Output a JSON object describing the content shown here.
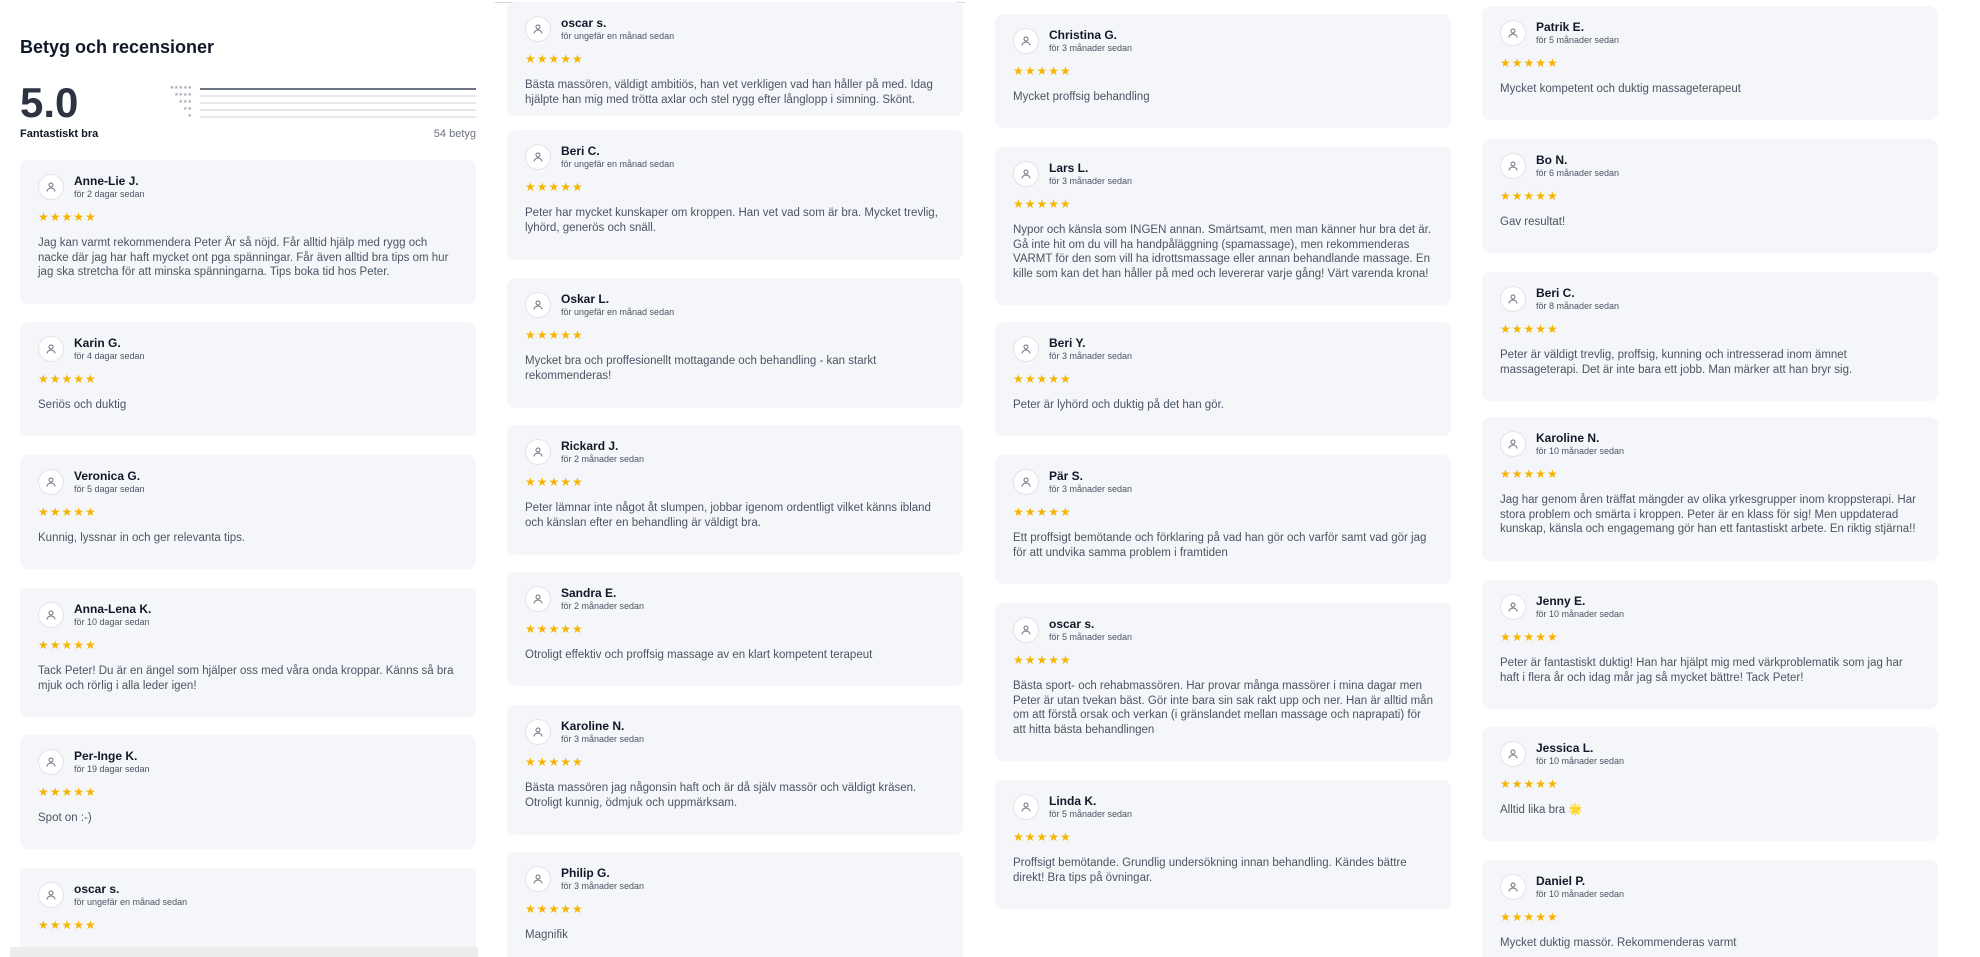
{
  "summary": {
    "title": "Betyg och recensioner",
    "score": "5.0",
    "score_label": "Fantastiskt bra",
    "count": "54 betyg",
    "distribution": [
      {
        "stars": 5,
        "share": 1.0
      },
      {
        "stars": 4,
        "share": 0
      },
      {
        "stars": 3,
        "share": 0
      },
      {
        "stars": 2,
        "share": 0
      },
      {
        "stars": 1,
        "share": 0
      }
    ]
  },
  "icons": {
    "avatar": "user-icon",
    "star": "star-icon"
  },
  "colors": {
    "star": "#f5b400",
    "card": "#f5f6fa"
  },
  "stars_text": "★★★★★",
  "columns": [
    [
      {
        "name": "Anne-Lie J.",
        "date": "för 2 dagar sedan",
        "text": "Jag kan varmt rekommendera Peter Är så nöjd. Får alltid hjälp med rygg och nacke där jag har haft mycket ont pga spänningar. Får även alltid bra tips om hur jag ska stretcha för att minska spänningarna. Tips boka tid hos Peter."
      },
      {
        "name": "Karin G.",
        "date": "för 4 dagar sedan",
        "text": "Seriös och duktig"
      },
      {
        "name": "Veronica G.",
        "date": "för 5 dagar sedan",
        "text": "Kunnig, lyssnar in och ger relevanta tips."
      },
      {
        "name": "Anna-Lena K.",
        "date": "för 10 dagar sedan",
        "text": "Tack Peter! Du är en ängel som hjälper oss med våra onda kroppar. Känns så bra mjuk och rörlig i alla leder igen!"
      },
      {
        "name": "Per-Inge K.",
        "date": "för 19 dagar sedan",
        "text": "Spot on :-)"
      },
      {
        "name": "oscar s.",
        "date": "för ungefär en månad sedan",
        "text": ""
      }
    ],
    [
      {
        "name": "oscar s.",
        "date": "för ungefär en månad sedan",
        "text": "Bästa massören, väldigt ambitiös, han vet verkligen vad han håller på med. Idag hjälpte han mig med trötta axlar och stel rygg efter långlopp i simning. Skönt."
      },
      {
        "name": "Beri C.",
        "date": "för ungefär en månad sedan",
        "text": "Peter har mycket kunskaper om kroppen. Han vet vad som är bra. Mycket trevlig, lyhörd, generös och snäll."
      },
      {
        "name": "Oskar L.",
        "date": "för ungefär en månad sedan",
        "text": "Mycket bra och proffesionellt mottagande och behandling - kan starkt rekommenderas!"
      },
      {
        "name": "Rickard J.",
        "date": "för 2 månader sedan",
        "text": "Peter lämnar inte något åt slumpen, jobbar igenom ordentligt vilket känns ibland och känslan efter en behandling är väldigt bra."
      },
      {
        "name": "Sandra E.",
        "date": "för 2 månader sedan",
        "text": "Otroligt effektiv och proffsig massage av en klart kompetent terapeut"
      },
      {
        "name": "Karoline N.",
        "date": "för 3 månader sedan",
        "text": "Bästa massören jag någonsin haft och är då själv massör och väldigt kräsen. Otroligt kunnig, ödmjuk och uppmärksam."
      },
      {
        "name": "Philip G.",
        "date": "för 3 månader sedan",
        "text": "Magnifik"
      }
    ],
    [
      {
        "name": "Christina G.",
        "date": "för 3 månader sedan",
        "text": "Mycket proffsig behandling"
      },
      {
        "name": "Lars L.",
        "date": "för 3 månader sedan",
        "text": "Nypor och känsla som INGEN annan. Smärtsamt, men man känner hur bra det är. Gå inte hit om du vill ha handpåläggning (spamassage), men rekommenderas VARMT för den som vill ha idrottsmassage eller annan behandlande massage. En kille som kan det han håller på med och levererar varje gång! Värt varenda krona!"
      },
      {
        "name": "Beri Y.",
        "date": "för 3 månader sedan",
        "text": "Peter är lyhörd och duktig på det han gör."
      },
      {
        "name": "Pär S.",
        "date": "för 3 månader sedan",
        "text": "Ett proffsigt bemötande och förklaring på vad han gör och varför samt vad gör jag för att undvika samma problem i framtiden"
      },
      {
        "name": "oscar s.",
        "date": "för 5 månader sedan",
        "text": "Bästa sport- och rehabmassören. Har provar många massörer i mina dagar men Peter är utan tvekan bäst. Gör inte bara sin sak rakt upp och ner. Han är alltid mån om att förstå orsak och verkan (i gränslandet mellan massage och naprapati) för att hitta bästa behandlingen"
      },
      {
        "name": "Linda K.",
        "date": "för 5 månader sedan",
        "text": "Proffsigt bemötande. Grundlig undersökning innan behandling. Kändes bättre direkt! Bra tips på övningar."
      }
    ],
    [
      {
        "name": "Patrik E.",
        "date": "för 5 månader sedan",
        "text": "Mycket kompetent och duktig massageterapeut"
      },
      {
        "name": "Bo N.",
        "date": "för 6 månader sedan",
        "text": "Gav resultat!"
      },
      {
        "name": "Beri C.",
        "date": "för 8 månader sedan",
        "text": "Peter är väldigt trevlig, proffsig, kunning och intresserad inom ämnet massageterapi. Det är inte bara ett jobb. Man märker att han bryr sig."
      },
      {
        "name": "Karoline N.",
        "date": "för 10 månader sedan",
        "text": "Jag har genom åren träffat mängder av olika yrkesgrupper inom kroppsterapi. Har stora problem och smärta i kroppen. Peter är en klass för sig! Men uppdaterad kunskap, känsla och engagemang gör han ett fantastiskt arbete. En riktig stjärna!!"
      },
      {
        "name": "Jenny E.",
        "date": "för 10 månader sedan",
        "text": "Peter är fantastiskt duktig! Han har hjälpt mig med värkproblematik som jag har haft i flera år och idag mår jag så mycket bättre! Tack Peter!"
      },
      {
        "name": "Jessica L.",
        "date": "för 10 månader sedan",
        "text": "Alltid lika bra 🌟"
      },
      {
        "name": "Daniel P.",
        "date": "för 10 månader sedan",
        "text": "Mycket duktig massör. Rekommenderas varmt"
      }
    ]
  ]
}
